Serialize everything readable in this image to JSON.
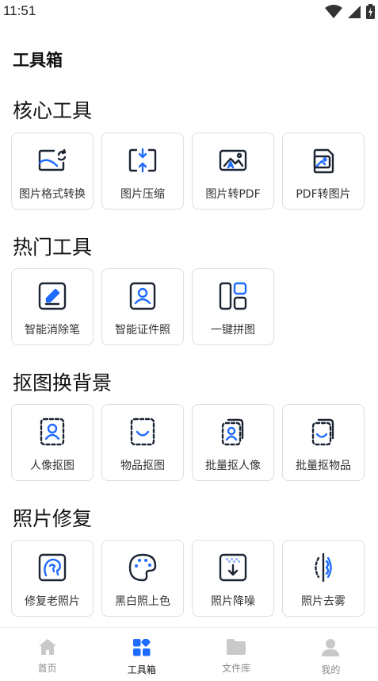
{
  "status": {
    "time": "11:51"
  },
  "page_title": "工具箱",
  "sections": [
    {
      "title": "核心工具",
      "items": [
        {
          "label": "图片格式转换",
          "icon": "image-convert-icon"
        },
        {
          "label": "图片压缩",
          "icon": "image-compress-icon"
        },
        {
          "label": "图片转PDF",
          "icon": "image-to-pdf-icon"
        },
        {
          "label": "PDF转图片",
          "icon": "pdf-to-image-icon"
        }
      ]
    },
    {
      "title": "热门工具",
      "items": [
        {
          "label": "智能消除笔",
          "icon": "eraser-pen-icon"
        },
        {
          "label": "智能证件照",
          "icon": "id-photo-icon"
        },
        {
          "label": "一键拼图",
          "icon": "collage-icon"
        }
      ]
    },
    {
      "title": "抠图换背景",
      "items": [
        {
          "label": "人像抠图",
          "icon": "portrait-cutout-icon"
        },
        {
          "label": "物品抠图",
          "icon": "object-cutout-icon"
        },
        {
          "label": "批量抠人像",
          "icon": "batch-portrait-icon"
        },
        {
          "label": "批量抠物品",
          "icon": "batch-object-icon"
        }
      ]
    },
    {
      "title": "照片修复",
      "items": [
        {
          "label": "修复老照片",
          "icon": "restore-photo-icon"
        },
        {
          "label": "黑白照上色",
          "icon": "palette-icon"
        },
        {
          "label": "照片降噪",
          "icon": "denoise-icon"
        },
        {
          "label": "照片去雾",
          "icon": "dehaze-icon"
        }
      ]
    }
  ],
  "tabs": [
    {
      "label": "首页",
      "icon": "home-icon",
      "active": false
    },
    {
      "label": "工具箱",
      "icon": "toolbox-icon",
      "active": true
    },
    {
      "label": "文件库",
      "icon": "folder-icon",
      "active": false
    },
    {
      "label": "我的",
      "icon": "user-icon",
      "active": false
    }
  ],
  "colors": {
    "accent": "#1f6bff",
    "icon_dark": "#1b2433",
    "tab_inactive": "#c9c9c9"
  }
}
